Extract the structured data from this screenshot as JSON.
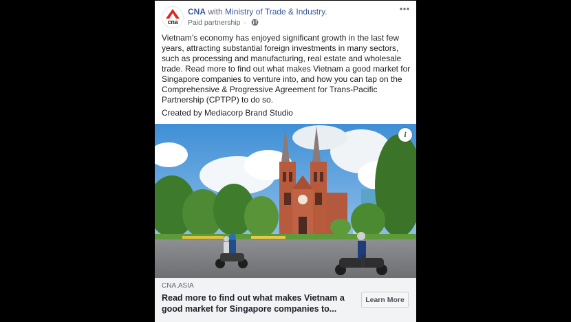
{
  "post": {
    "page_name": "CNA",
    "with_text": "with",
    "partner_name": "Ministry of Trade & Industry.",
    "meta_label": "Paid partnership",
    "meta_separator": "·",
    "more_icon": "more-options-icon",
    "logo_text": "cna",
    "body": "Vietnam’s economy has enjoyed significant growth in the last few years, attracting substantial foreign investments in many sectors, such as processing and manufacturing, real estate and wholesale trade. Read more to find out what makes Vietnam a good market for Singapore companies to venture into, and how you can tap on the Comprehensive & Progressive Agreement for Trans-Pacific Partnership (CPTPP) to do so.",
    "credit": "Created by Mediacorp Brand Studio",
    "info_label": "i"
  },
  "link_preview": {
    "domain": "CNA.ASIA",
    "headline": "Read more to find out what makes Vietnam a good market for Singapore companies to...",
    "cta_label": "Learn More"
  },
  "colors": {
    "brand_red": "#e1251b",
    "link_blue": "#385898",
    "page_background": "#000000"
  }
}
